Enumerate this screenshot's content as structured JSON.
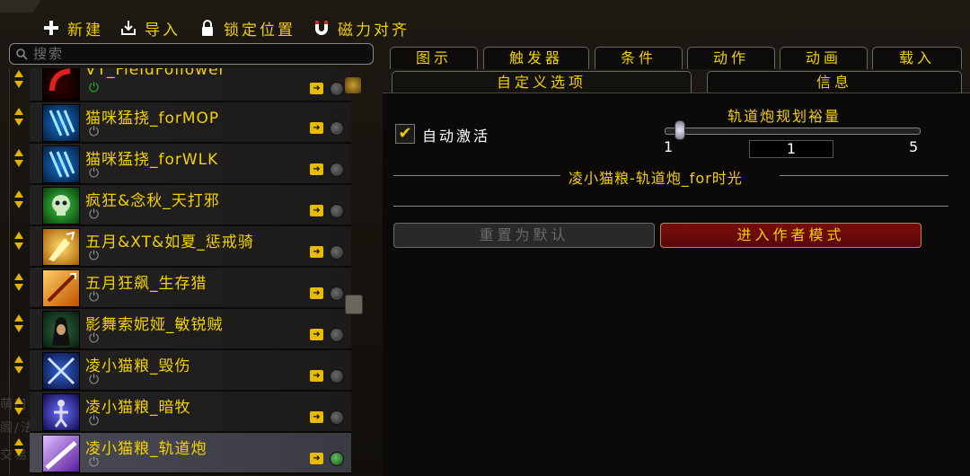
{
  "toolbar": {
    "new_label": "新建",
    "import_label": "导入",
    "lock_label": "锁定位置",
    "magnet_label": "磁力对齐"
  },
  "search": {
    "placeholder": "搜索"
  },
  "list": {
    "items": [
      {
        "name": "VT_FieldFollower",
        "power_on": true
      },
      {
        "name": "猫咪猛挠_forMOP",
        "power_on": false
      },
      {
        "name": "猫咪猛挠_forWLK",
        "power_on": false
      },
      {
        "name": "疯狂&念秋_天打邪",
        "power_on": false
      },
      {
        "name": "五月&XT&如夏_惩戒骑",
        "power_on": false
      },
      {
        "name": "五月狂飙_生存猎",
        "power_on": false
      },
      {
        "name": "影舞索妮娅_敏锐贼",
        "power_on": false
      },
      {
        "name": "凌小猫粮_毁伤",
        "power_on": false
      },
      {
        "name": "凌小猫粮_暗牧",
        "power_on": false
      },
      {
        "name": "凌小猫粮_轨道炮",
        "power_on": false,
        "selected": true
      }
    ]
  },
  "tabs": {
    "row1": [
      "图示",
      "触发器",
      "条件",
      "动作",
      "动画",
      "载入"
    ],
    "row2": [
      "自定义选项",
      "信息"
    ]
  },
  "options": {
    "auto_activate_label": "自动激活",
    "auto_activate_checked": true,
    "slider": {
      "title": "轨道炮规划裕量",
      "min": "1",
      "max": "5",
      "value": "1"
    },
    "section_title": "凌小猫粮-轨道炮_for时光",
    "reset_button": "重置为默认",
    "author_mode_button": "进入作者模式"
  },
  "colors": {
    "accent_gold": "#f2d000",
    "author_button": "#7a0c0c"
  }
}
